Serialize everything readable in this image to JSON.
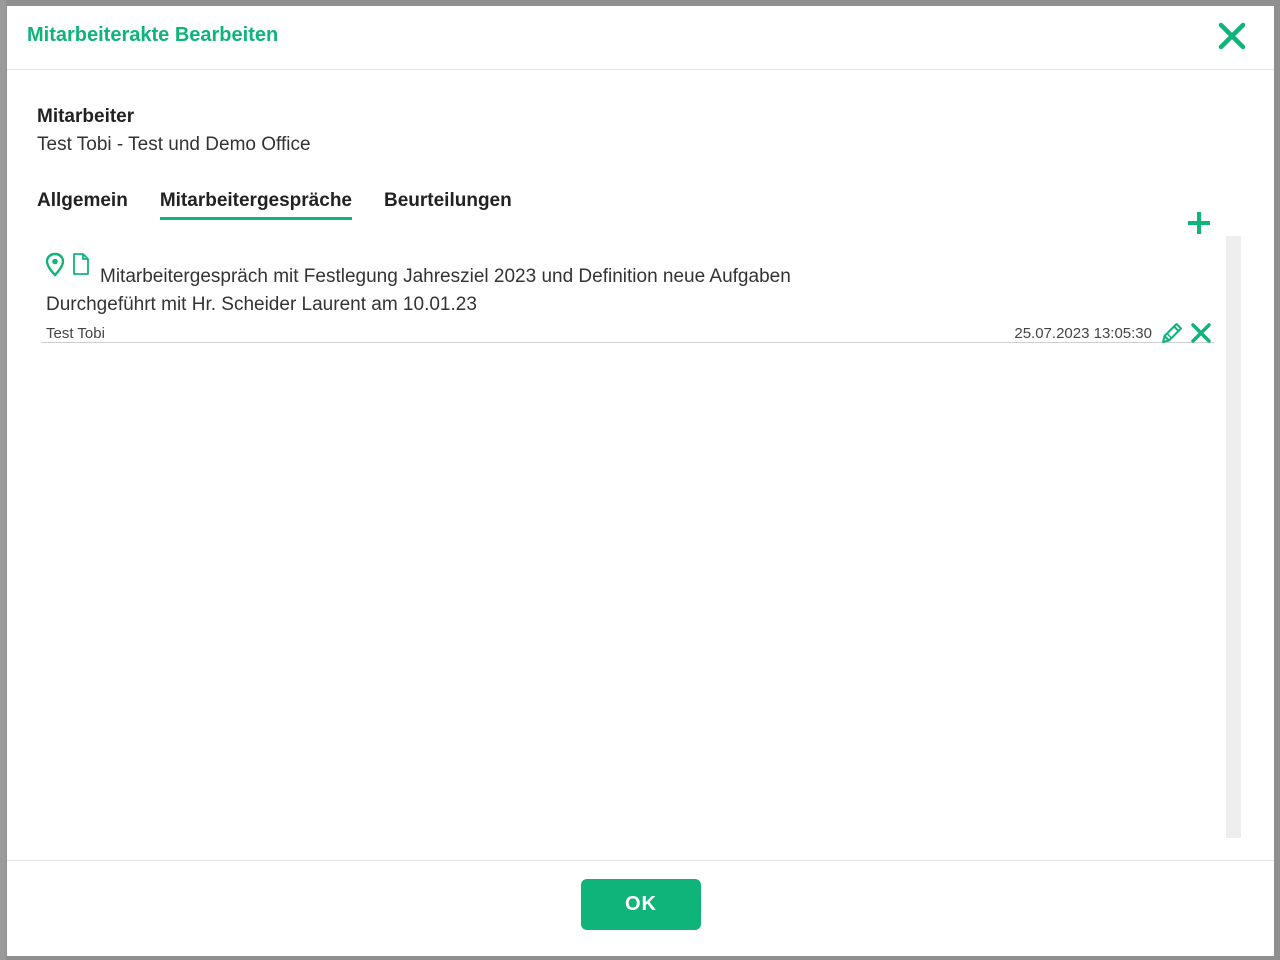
{
  "dialog": {
    "title": "Mitarbeiterakte Bearbeiten",
    "accent_color": "#0fb47a"
  },
  "employee": {
    "label": "Mitarbeiter",
    "value": "Test Tobi - Test und Demo Office"
  },
  "tabs": [
    {
      "label": "Allgemein",
      "active": false
    },
    {
      "label": "Mitarbeitergespräche",
      "active": true
    },
    {
      "label": "Beurteilungen",
      "active": false
    }
  ],
  "icons": {
    "close": "close-icon",
    "add": "plus-icon",
    "location": "map-pin-icon",
    "document": "document-icon",
    "edit": "pencil-icon",
    "delete": "close-icon"
  },
  "entries": [
    {
      "title": "Mitarbeitergespräch mit Festlegung Jahresziel 2023 und Definition neue Aufgaben",
      "details": "Durchgeführt mit Hr. Scheider Laurent am 10.01.23",
      "author": "Test Tobi",
      "timestamp": "25.07.2023 13:05:30"
    }
  ],
  "footer": {
    "ok_label": "OK"
  }
}
